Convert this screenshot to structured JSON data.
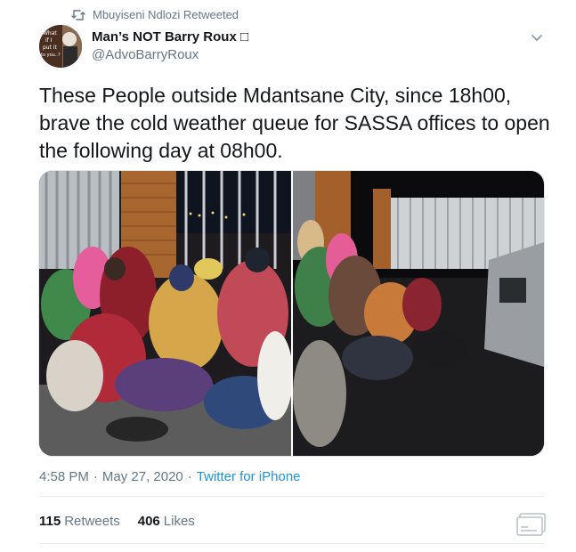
{
  "retweet_banner": {
    "icon": "retweet-icon",
    "text": "Mbuyiseni Ndlozi Retweeted"
  },
  "author": {
    "display_name": "Man’s NOT Barry Roux □",
    "handle": "@AdvoBarryRoux",
    "avatar_text": [
      "What",
      "if I",
      "put it",
      "to you..?"
    ]
  },
  "tweet": {
    "text_lines": [
      "These People outside Mdantsane City, since 18h00,",
      "brave the cold weather queue for SASSA offices to open",
      "the following day at 08h00."
    ]
  },
  "meta": {
    "time": "4:58 PM",
    "separator": "·",
    "date": "May 27, 2020",
    "source": "Twitter for iPhone"
  },
  "stats": {
    "retweets_count": "115",
    "retweets_label": "Retweets",
    "likes_count": "406",
    "likes_label": "Likes"
  },
  "colors": {
    "link": "#1b95e0",
    "secondary_text": "#657786",
    "primary_text": "#14171a",
    "divider": "#e6ecf0"
  },
  "icons": {
    "caret": "chevron-down-icon",
    "share": "screenshot-share-icon"
  }
}
